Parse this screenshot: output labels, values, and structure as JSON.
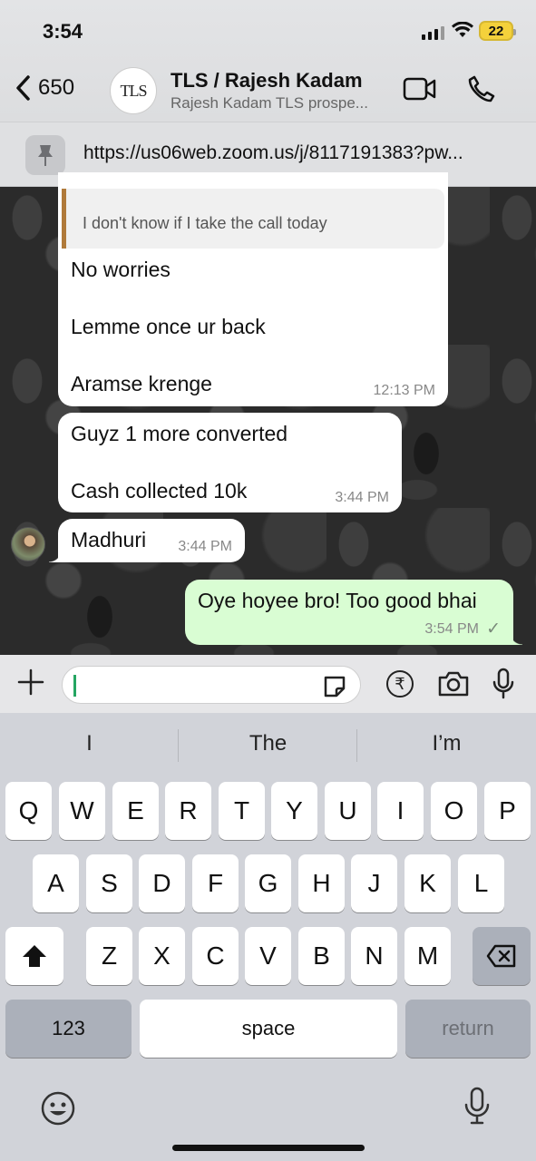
{
  "status_bar": {
    "time": "3:54",
    "battery": "22"
  },
  "header": {
    "back_count": "650",
    "avatar_text": "TLS",
    "contact_name": "TLS / Rajesh Kadam",
    "contact_subtitle": "Rajesh Kadam TLS prospe..."
  },
  "pinned": {
    "text": "https://us06web.zoom.us/j/8117191383?pw..."
  },
  "messages": [
    {
      "quote": "I don't know if I take the call today",
      "lines": [
        "No worries",
        "Lemme once ur back",
        "Aramse krenge"
      ],
      "time": "12:13 PM"
    },
    {
      "lines": [
        "Guyz 1 more converted",
        "Cash collected 10k"
      ],
      "time": "3:44 PM"
    },
    {
      "lines": [
        "Madhuri"
      ],
      "time": "3:44 PM"
    },
    {
      "lines": [
        "Oye hoyee bro! Too good bhai"
      ],
      "time": "3:54 PM",
      "status": "✓"
    }
  ],
  "composer": {
    "value": "",
    "rupee": "₹"
  },
  "keyboard": {
    "suggestions": [
      "I",
      "The",
      "I’m"
    ],
    "row1": [
      "Q",
      "W",
      "E",
      "R",
      "T",
      "Y",
      "U",
      "I",
      "O",
      "P"
    ],
    "row2": [
      "A",
      "S",
      "D",
      "F",
      "G",
      "H",
      "J",
      "K",
      "L"
    ],
    "row3": [
      "Z",
      "X",
      "C",
      "V",
      "B",
      "N",
      "M"
    ],
    "numbers": "123",
    "space": "space",
    "return": "return"
  },
  "colors": {
    "outgoing_bubble": "#d9fdd3",
    "incoming_bubble": "#ffffff",
    "accent": "#25a562"
  }
}
